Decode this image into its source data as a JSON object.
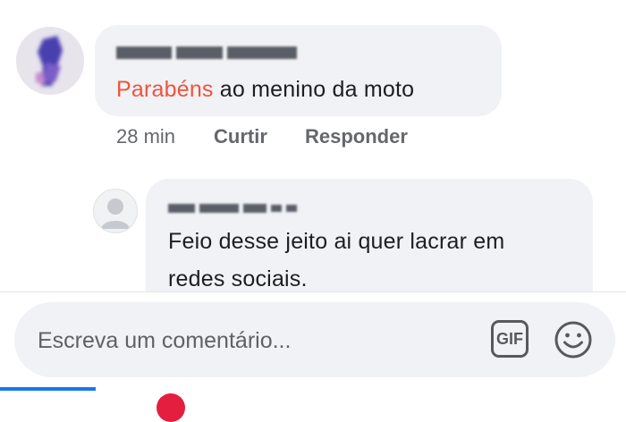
{
  "comments": [
    {
      "highlight": "Parabéns",
      "rest": " ao menino da moto",
      "time": "28 min",
      "like_label": "Curtir",
      "reply_label": "Responder"
    },
    {
      "line1": "Feio desse jeito ai quer lacrar em",
      "line2": "redes sociais."
    }
  ],
  "composer": {
    "placeholder": "Escreva um comentário...",
    "gif_label": "GIF"
  },
  "colors": {
    "highlight": "#f0533e",
    "bubble": "#f0f2f5",
    "active_tab": "#1877f2"
  },
  "icons": [
    "gif-icon",
    "smiley-icon",
    "default-avatar-icon"
  ]
}
